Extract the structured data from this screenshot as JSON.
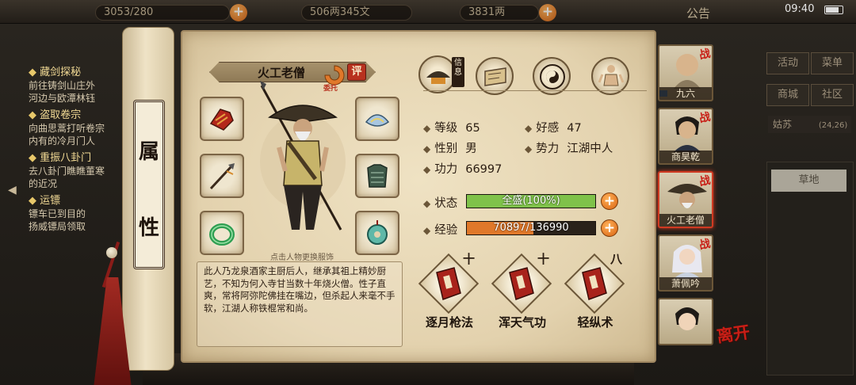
{
  "status_bar": {
    "time": "09:40"
  },
  "top_bar": {
    "resource_1": "3053/280",
    "resource_2": "506两345文",
    "resource_3": "3831两",
    "announcement": "公告"
  },
  "quests": [
    {
      "title": "藏剑探秘",
      "desc": "前往铸剑山庄外\n河边与欧潭林钰"
    },
    {
      "title": "盗取卷宗",
      "desc": "向曲思蒿打听卷宗\n内有的冷月门人"
    },
    {
      "title": "重振八卦门",
      "desc": "去八卦门瞧瞧董寒\n的近况"
    },
    {
      "title": "运镖",
      "desc": "镖车已到目的\n扬威镖局领取"
    }
  ],
  "right_menu": {
    "buttons": [
      "活动",
      "菜单",
      "商城",
      "社区"
    ],
    "location": "姑苏",
    "coords": "(24,26)",
    "terrain": "草地"
  },
  "scroll_label": [
    "属",
    "性"
  ],
  "character": {
    "name": "火工老僧",
    "eval_badge": "评",
    "delegate_label": "委托",
    "hint": "点击人物更换服饰",
    "bio": "此人乃龙泉酒家主厨后人，继承其祖上精妙厨艺，不知为何入寺甘当数十年烧火僧。性子直爽，常将阿弥陀佛挂在嘴边，但杀起人来毫不手软，江湖人称铁棍常和尚。"
  },
  "tabs": {
    "active_label": "信息",
    "icons": [
      "info-hat-icon",
      "scroll-map-icon",
      "bagua-icon",
      "body-meridian-icon"
    ]
  },
  "stats": {
    "level_label": "等级",
    "level": "65",
    "favor_label": "好感",
    "favor": "47",
    "gender_label": "性别",
    "gender": "男",
    "faction_label": "势力",
    "faction": "江湖中人",
    "power_label": "功力",
    "power": "66997",
    "state_label": "状态",
    "state_text": "全盛(100%)",
    "state_fraction": 1.0,
    "exp_label": "经验",
    "exp_text": "70897/136990",
    "exp_fraction": 0.5175
  },
  "skills": [
    {
      "level": "十",
      "name": "逐月枪法"
    },
    {
      "level": "十",
      "name": "浑天气功"
    },
    {
      "level": "八",
      "name": "轻纵术"
    }
  ],
  "party": [
    {
      "name": "九六",
      "battle_mark": "战",
      "active": false
    },
    {
      "name": "商昊乾",
      "battle_mark": "战",
      "active": false
    },
    {
      "name": "火工老僧",
      "battle_mark": "战",
      "active": true
    },
    {
      "name": "萧佩吟",
      "battle_mark": "战",
      "active": false
    },
    {
      "name": "",
      "battle_mark": "",
      "active": false
    }
  ],
  "leave_label": "离开",
  "colors": {
    "state_bar": "#7fc24a",
    "exp_bar": "#e0782a",
    "accent_red": "#c81e16",
    "paper": "#e8d9b7"
  }
}
